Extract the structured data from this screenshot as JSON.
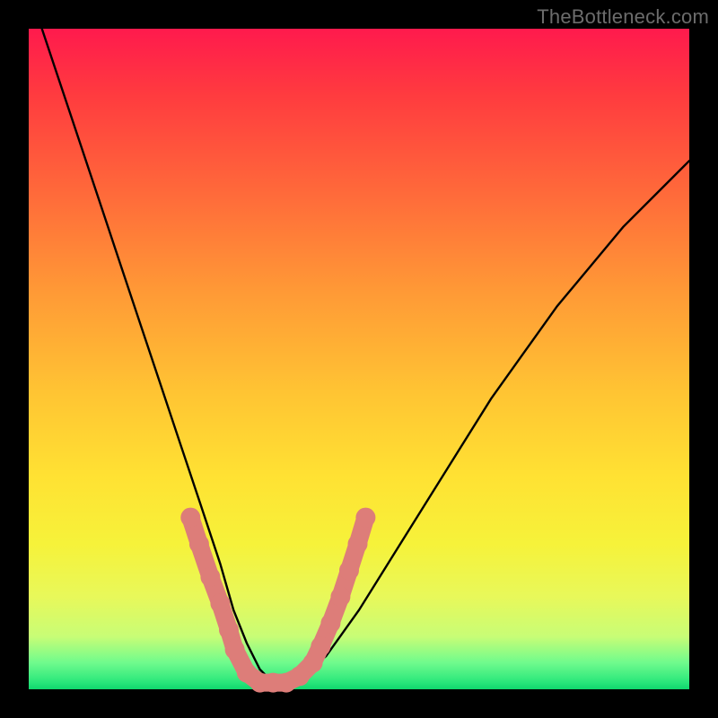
{
  "watermark": "TheBottleneck.com",
  "chart_data": {
    "type": "line",
    "title": "",
    "xlabel": "",
    "ylabel": "",
    "xlim": [
      0,
      100
    ],
    "ylim": [
      0,
      100
    ],
    "series": [
      {
        "name": "bottleneck-curve",
        "x": [
          2,
          5,
          8,
          11,
          14,
          17,
          20,
          23,
          26,
          29,
          31,
          33,
          35,
          37,
          40,
          45,
          50,
          55,
          60,
          65,
          70,
          75,
          80,
          85,
          90,
          95,
          100
        ],
        "y": [
          100,
          91,
          82,
          73,
          64,
          55,
          46,
          37,
          28,
          19,
          12,
          7,
          3,
          1,
          1,
          5,
          12,
          20,
          28,
          36,
          44,
          51,
          58,
          64,
          70,
          75,
          80
        ]
      }
    ],
    "markers": {
      "name": "highlighted-points",
      "color": "#dd7d79",
      "points": [
        {
          "x": 24.5,
          "y": 26
        },
        {
          "x": 25.8,
          "y": 22
        },
        {
          "x": 27.5,
          "y": 17
        },
        {
          "x": 29.0,
          "y": 13
        },
        {
          "x": 30.3,
          "y": 9
        },
        {
          "x": 31.2,
          "y": 6
        },
        {
          "x": 33.0,
          "y": 2.5
        },
        {
          "x": 35.0,
          "y": 1
        },
        {
          "x": 37.0,
          "y": 1
        },
        {
          "x": 39.0,
          "y": 1
        },
        {
          "x": 41.0,
          "y": 2
        },
        {
          "x": 43.0,
          "y": 4
        },
        {
          "x": 44.2,
          "y": 6.5
        },
        {
          "x": 45.7,
          "y": 10
        },
        {
          "x": 47.2,
          "y": 14
        },
        {
          "x": 48.5,
          "y": 18
        },
        {
          "x": 49.8,
          "y": 22
        },
        {
          "x": 51.0,
          "y": 26
        }
      ]
    }
  }
}
